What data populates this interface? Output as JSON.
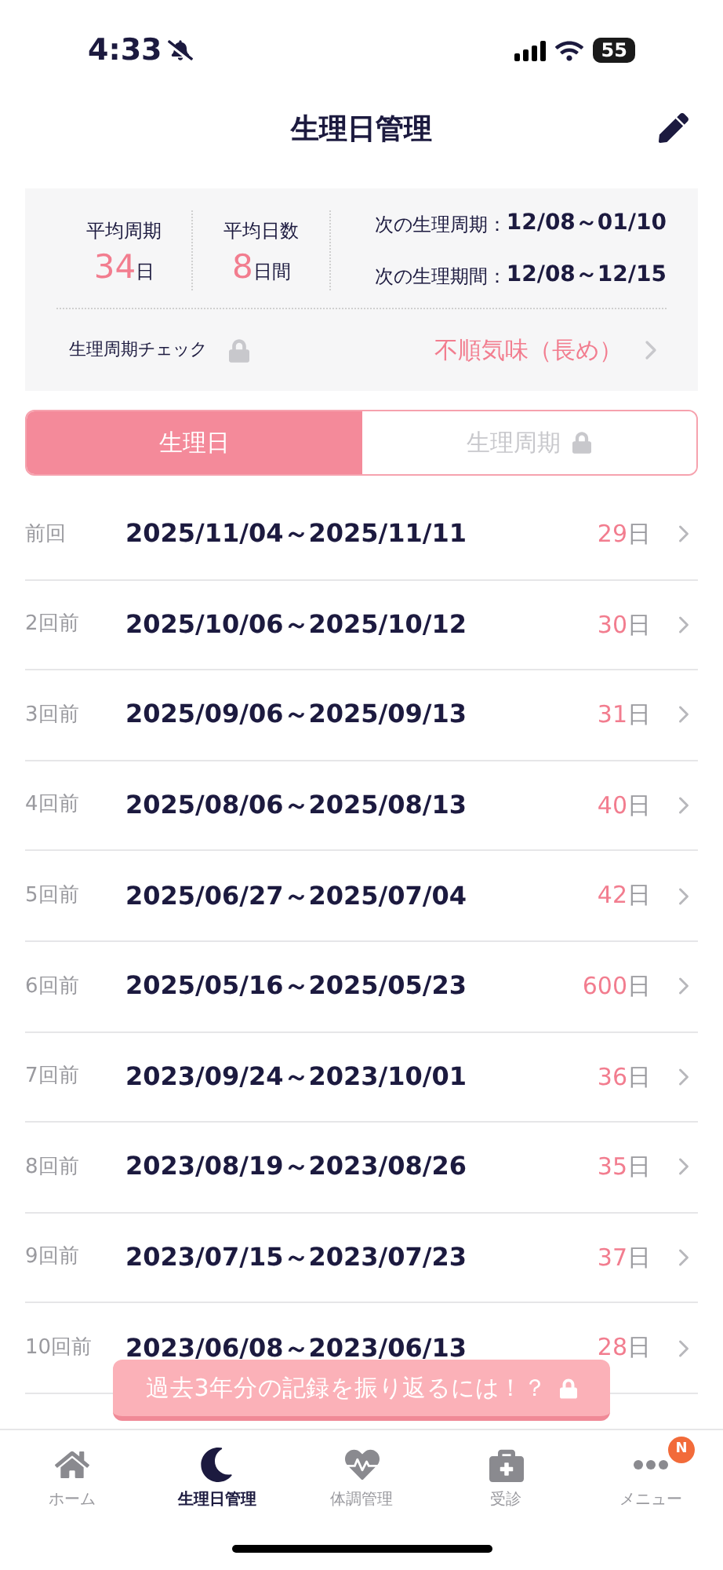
{
  "status_bar": {
    "time": "4:33",
    "muted": true,
    "battery": "55"
  },
  "header": {
    "title": "生理日管理"
  },
  "summary": {
    "stats": [
      {
        "label": "平均周期",
        "value": "34",
        "unit": "日"
      },
      {
        "label": "平均日数",
        "value": "8",
        "unit": "日間"
      }
    ],
    "next": [
      {
        "label": "次の生理周期：",
        "value": "12/08～01/10"
      },
      {
        "label": "次の生理期間：",
        "value": "12/08～12/15"
      }
    ],
    "check": {
      "label": "生理周期チェック",
      "locked": true,
      "value": "不順気味（長め）"
    }
  },
  "tabs": [
    {
      "label": "生理日",
      "selected": true,
      "locked": false
    },
    {
      "label": "生理周期",
      "selected": false,
      "locked": true
    }
  ],
  "periods": [
    {
      "label": "前回",
      "dates": "2025/11/04～2025/11/11",
      "days": "29",
      "unit": "日"
    },
    {
      "label": "2回前",
      "dates": "2025/10/06～2025/10/12",
      "days": "30",
      "unit": "日"
    },
    {
      "label": "3回前",
      "dates": "2025/09/06～2025/09/13",
      "days": "31",
      "unit": "日"
    },
    {
      "label": "4回前",
      "dates": "2025/08/06～2025/08/13",
      "days": "40",
      "unit": "日"
    },
    {
      "label": "5回前",
      "dates": "2025/06/27～2025/07/04",
      "days": "42",
      "unit": "日"
    },
    {
      "label": "6回前",
      "dates": "2025/05/16～2025/05/23",
      "days": "600",
      "unit": "日"
    },
    {
      "label": "7回前",
      "dates": "2023/09/24～2023/10/01",
      "days": "36",
      "unit": "日"
    },
    {
      "label": "8回前",
      "dates": "2023/08/19～2023/08/26",
      "days": "35",
      "unit": "日"
    },
    {
      "label": "9回前",
      "dates": "2023/07/15～2023/07/23",
      "days": "37",
      "unit": "日"
    },
    {
      "label": "10回前",
      "dates": "2023/06/08～2023/06/13",
      "days": "28",
      "unit": "日"
    }
  ],
  "promo_button": {
    "label": "過去3年分の記録を振り返るには！？",
    "locked": true
  },
  "bottom_nav": [
    {
      "kind": "home",
      "label": "ホーム",
      "selected": false
    },
    {
      "kind": "moon",
      "label": "生理日管理",
      "selected": true
    },
    {
      "kind": "health",
      "label": "体調管理",
      "selected": false
    },
    {
      "kind": "clinic",
      "label": "受診",
      "selected": false
    },
    {
      "kind": "menu",
      "label": "メニュー",
      "selected": false,
      "badge": "N"
    }
  ]
}
